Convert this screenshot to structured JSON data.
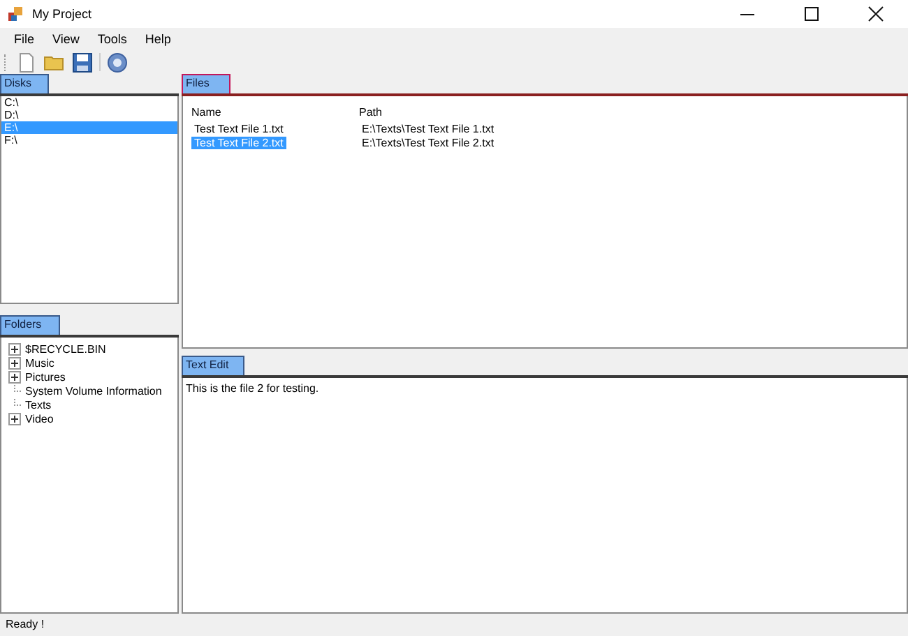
{
  "window": {
    "title": "My Project"
  },
  "menu": [
    "File",
    "View",
    "Tools",
    "Help"
  ],
  "toolbar": [
    {
      "kind": "new"
    },
    {
      "kind": "open"
    },
    {
      "kind": "save"
    },
    {
      "kind": "help"
    }
  ],
  "disks": {
    "tab": {
      "label": "Disks",
      "focused": false
    },
    "items": [
      {
        "label": "C:\\",
        "selected": false
      },
      {
        "label": "D:\\",
        "selected": false
      },
      {
        "label": "E:\\",
        "selected": true
      },
      {
        "label": "F:\\",
        "selected": false
      }
    ]
  },
  "folders": {
    "tab": {
      "label": "Folders",
      "focused": false
    },
    "items": [
      {
        "label": "$RECYCLE.BIN",
        "kind": "branch"
      },
      {
        "label": "Music",
        "kind": "branch"
      },
      {
        "label": "Pictures",
        "kind": "branch"
      },
      {
        "label": "System Volume Information",
        "kind": "leaf"
      },
      {
        "label": "Texts",
        "kind": "leaf"
      },
      {
        "label": "Video",
        "kind": "branch"
      }
    ]
  },
  "files": {
    "tab": {
      "label": "Files",
      "focused": true
    },
    "columns": [
      "Name",
      "Path"
    ],
    "rows": [
      {
        "cells": [
          "Test Text File 1.txt",
          "E:\\Texts\\Test Text File 1.txt"
        ],
        "selected": false
      },
      {
        "cells": [
          "Test Text File 2.txt",
          "E:\\Texts\\Test Text File 2.txt"
        ],
        "selected": true
      }
    ]
  },
  "text_edit": {
    "tab": {
      "label": "Text Edit",
      "focused": false
    },
    "value": "This is the file 2 for testing."
  },
  "status_bar": "Ready !"
}
